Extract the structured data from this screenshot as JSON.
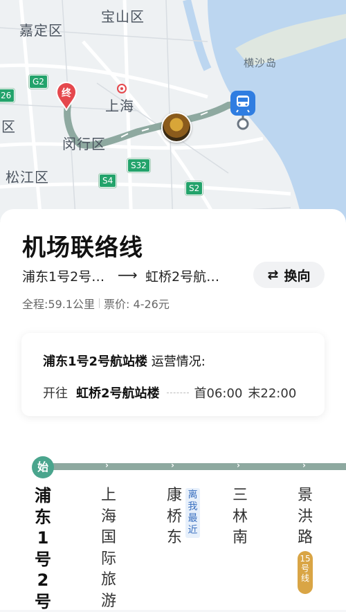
{
  "map": {
    "labels": [
      "宝山区",
      "嘉定区",
      "横沙岛",
      "上海",
      "闵行区",
      "松江区",
      "区"
    ],
    "shields": [
      "G2",
      "S32",
      "S4",
      "S2",
      "26"
    ],
    "end_marker": "终"
  },
  "route": {
    "title": "机场联络线",
    "from": "浦东1号2号…",
    "arrow": "⟶",
    "to": "虹桥2号航…",
    "switch_label": "换向",
    "switch_icon": "⇄",
    "distance": "全程:59.1公里",
    "price": "票价: 4-26元"
  },
  "status_card": {
    "station": "浦东1号2号航站楼",
    "status_label": "运营情况:",
    "toward": "开往",
    "destination": "虹桥2号航站楼",
    "first": "首06:00",
    "last": "末22:00"
  },
  "line_strip": {
    "start_badge": "始",
    "stations": [
      "浦东1号2号",
      "上海国际旅游",
      "康桥东",
      "三林南",
      "景洪路"
    ],
    "near_tag": "离我最近",
    "transfer_tag": "15号线"
  },
  "colors": {
    "line": "#8ea9a0",
    "start": "#4aa58d",
    "rail_icon": "#2f7de1",
    "transfer": "#d9a545",
    "end": "#e5484d"
  }
}
